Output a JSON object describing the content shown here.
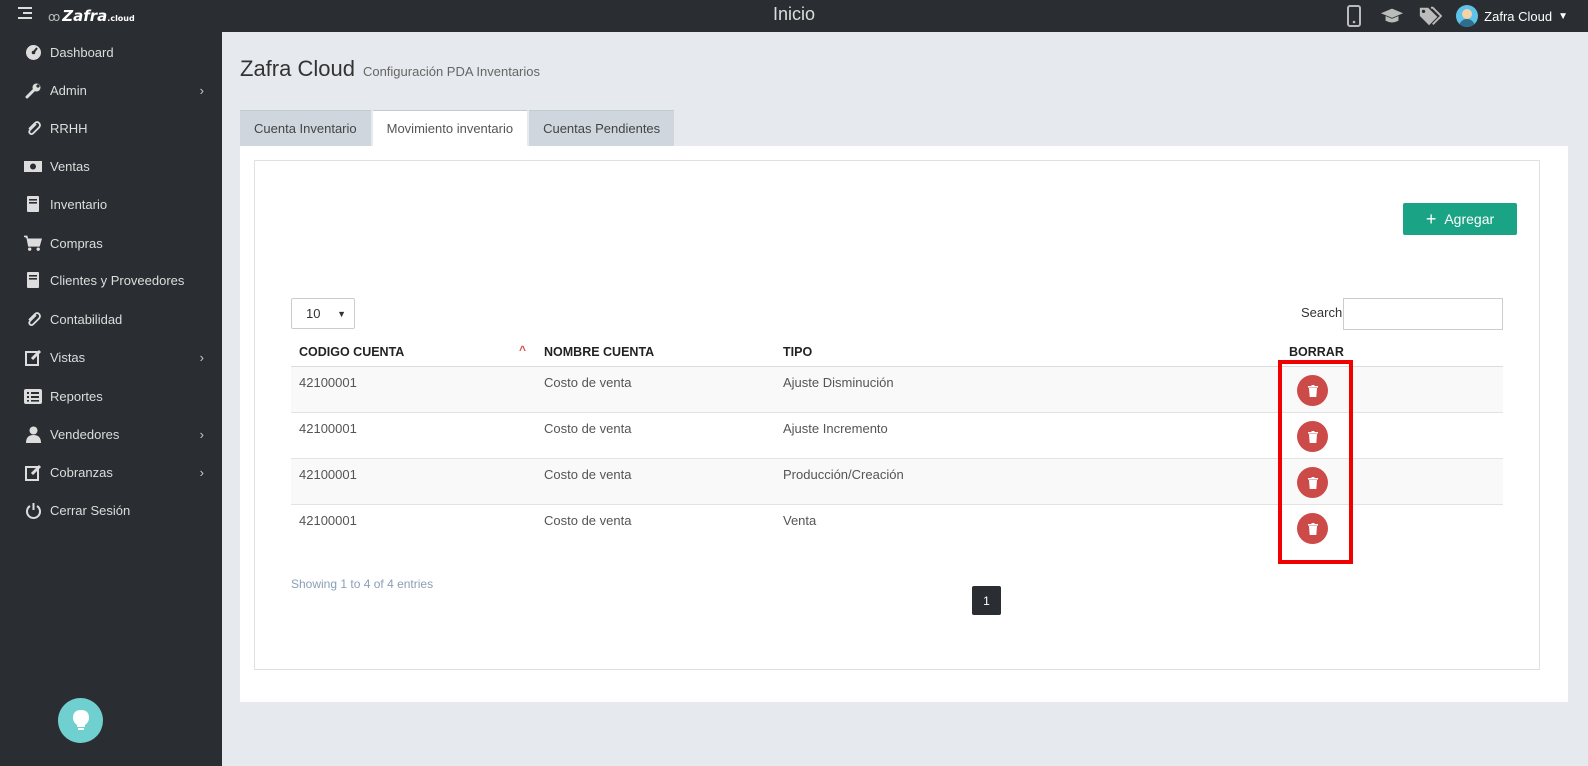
{
  "topbar": {
    "logo_name": "Zafra",
    "logo_tld": ".cloud",
    "title": "Inicio",
    "user_name": "Zafra Cloud",
    "icons": [
      "mobile-icon",
      "graduation-cap-icon",
      "tags-icon"
    ]
  },
  "sidebar": {
    "items": [
      {
        "label": "Dashboard",
        "icon": "dashboard-icon",
        "has_submenu": false
      },
      {
        "label": "Admin",
        "icon": "wrench-icon",
        "has_submenu": true
      },
      {
        "label": "RRHH",
        "icon": "paperclip-icon",
        "has_submenu": false
      },
      {
        "label": "Ventas",
        "icon": "money-icon",
        "has_submenu": false
      },
      {
        "label": "Inventario",
        "icon": "book-icon",
        "has_submenu": false
      },
      {
        "label": "Compras",
        "icon": "cart-icon",
        "has_submenu": false
      },
      {
        "label": "Clientes y Proveedores",
        "icon": "book-icon",
        "has_submenu": false
      },
      {
        "label": "Contabilidad",
        "icon": "paperclip-icon",
        "has_submenu": false
      },
      {
        "label": "Vistas",
        "icon": "edit-icon",
        "has_submenu": true
      },
      {
        "label": "Reportes",
        "icon": "list-icon",
        "has_submenu": false
      },
      {
        "label": "Vendedores",
        "icon": "user-icon",
        "has_submenu": true
      },
      {
        "label": "Cobranzas",
        "icon": "edit-icon",
        "has_submenu": true
      },
      {
        "label": "Cerrar Sesión",
        "icon": "power-icon",
        "has_submenu": false
      }
    ]
  },
  "page": {
    "title": "Zafra Cloud",
    "subtitle": "Configuración PDA Inventarios"
  },
  "tabs": [
    {
      "label": "Cuenta Inventario",
      "active": false
    },
    {
      "label": "Movimiento inventario",
      "active": true
    },
    {
      "label": "Cuentas Pendientes",
      "active": false
    }
  ],
  "toolbar": {
    "add_label": "Agregar",
    "page_length": "10",
    "search_label": "Search:",
    "search_value": ""
  },
  "table": {
    "headers": [
      "CODIGO CUENTA",
      "NOMBRE CUENTA",
      "TIPO",
      "BORRAR"
    ],
    "rows": [
      {
        "codigo": "42100001",
        "nombre": "Costo de venta",
        "tipo": "Ajuste Disminución"
      },
      {
        "codigo": "42100001",
        "nombre": "Costo de venta",
        "tipo": "Ajuste Incremento"
      },
      {
        "codigo": "42100001",
        "nombre": "Costo de venta",
        "tipo": "Producción/Creación"
      },
      {
        "codigo": "42100001",
        "nombre": "Costo de venta",
        "tipo": "Venta"
      }
    ]
  },
  "footer": {
    "info": "Showing 1 to 4 of 4 entries",
    "current_page": "1"
  },
  "colors": {
    "sidebar_bg": "#2a2d31",
    "accent_green": "#1aa385",
    "delete_red": "#cc4a48",
    "highlight_red": "#f10000"
  }
}
